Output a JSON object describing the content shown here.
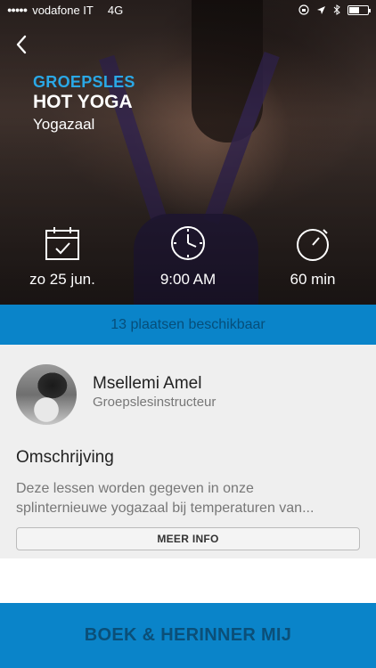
{
  "status_bar": {
    "carrier": "vodafone IT",
    "network": "4G",
    "time": "",
    "icons": [
      "lock-rotation-icon",
      "location-icon",
      "bluetooth-icon",
      "battery-icon"
    ]
  },
  "hero": {
    "type": "GROEPSLES",
    "title": "HOT YOGA",
    "room": "Yogazaal",
    "date": "zo 25 jun.",
    "time": "9:00 AM",
    "duration": "60 min"
  },
  "availability": "13 plaatsen beschikbaar",
  "instructor": {
    "name": "Msellemi Amel",
    "role": "Groepslesinstructeur"
  },
  "description": {
    "title": "Omschrijving",
    "line1": "Deze lessen worden gegeven in onze",
    "line2": "splinternieuwe yogazaal bij temperaturen van...",
    "more_label": "MEER INFO"
  },
  "book_label": "BOEK & HERINNER MIJ",
  "colors": {
    "accent": "#0a84c9",
    "type_label": "#2aa8e6",
    "background": "#efefef"
  }
}
